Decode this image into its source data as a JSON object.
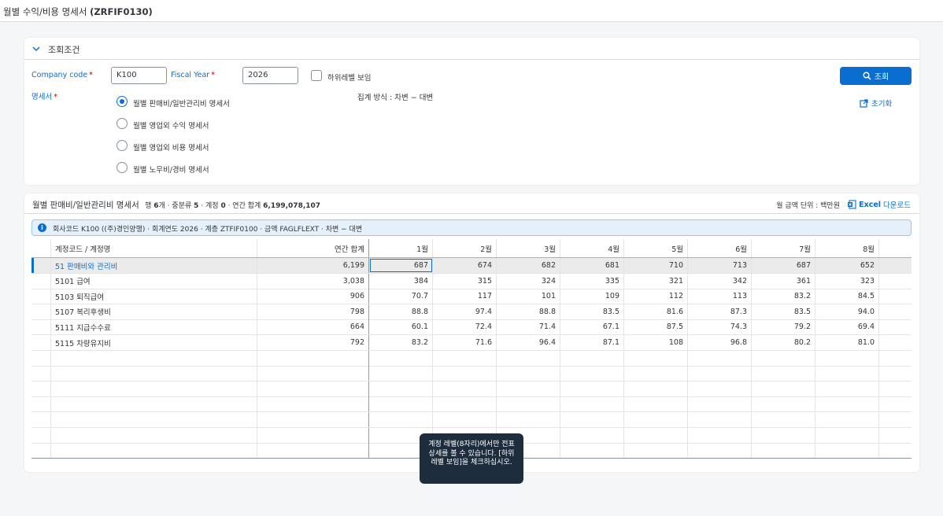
{
  "app": {
    "title_prefix": "월별 수익/비용 명세서",
    "title_code": "(ZRFIF0130)"
  },
  "conditions": {
    "section_title": "조회조건",
    "company_code_label": "Company code",
    "company_code_value": "K100",
    "fiscal_year_label": "Fiscal Year",
    "fiscal_year_value": "2026",
    "show_sublevel_label": "하위레벨 보임",
    "statement_label": "명세서",
    "aggregation_note": "집계 방식 : 차변 − 대변",
    "search_label": "조회",
    "reset_label": "초기화",
    "required_mark": "*",
    "statements": [
      {
        "label": "월별 판매비/일반관리비 명세서",
        "selected": true
      },
      {
        "label": "월별 영업외 수익 명세서",
        "selected": false
      },
      {
        "label": "월별 영업외 비용 명세서",
        "selected": false
      },
      {
        "label": "월별 노무비/경비 명세서",
        "selected": false
      }
    ]
  },
  "results": {
    "title": "월별 판매비/일반관리비 명세서",
    "meta_rows_label": "행",
    "meta_rows": "6",
    "meta_rows_unit": "개 · 중분류",
    "meta_mid": "5",
    "meta_acct_label": " · 계정",
    "meta_acct": "0",
    "meta_total_label": " · 연간 합계",
    "meta_total": "6,199,078,107",
    "unit_label": "월 금액 단위 :",
    "unit_value": "백만원",
    "excel_bold": "Excel",
    "excel_rest": "다운로드",
    "info": "회사코드 K100 ((주)경인양행) · 회계연도 2026 · 계층 ZTFIF0100 · 금액 FAGLFLEXT · 차변 − 대변",
    "columns": {
      "account": "계정코드 / 계정명",
      "annual": "연간 합계",
      "months": [
        "1월",
        "2월",
        "3월",
        "4월",
        "5월",
        "6월",
        "7월",
        "8월"
      ]
    },
    "rows": [
      {
        "name": "51 판매비와 관리비",
        "annual": "6,199",
        "m": [
          "687",
          "674",
          "682",
          "681",
          "710",
          "713",
          "687",
          "652"
        ]
      },
      {
        "name": "5101 급여",
        "annual": "3,038",
        "m": [
          "384",
          "315",
          "324",
          "335",
          "321",
          "342",
          "361",
          "323"
        ]
      },
      {
        "name": "5103 퇴직급여",
        "annual": "906",
        "m": [
          "70.7",
          "117",
          "101",
          "109",
          "112",
          "113",
          "83.2",
          "84.5"
        ]
      },
      {
        "name": "5107 복리후생비",
        "annual": "798",
        "m": [
          "88.8",
          "97.4",
          "88.8",
          "83.5",
          "81.6",
          "87.3",
          "83.5",
          "94.0"
        ]
      },
      {
        "name": "5111 지급수수료",
        "annual": "664",
        "m": [
          "60.1",
          "72.4",
          "71.4",
          "67.1",
          "87.5",
          "74.3",
          "79.2",
          "69.4"
        ]
      },
      {
        "name": "5115 차량유지비",
        "annual": "792",
        "m": [
          "83.2",
          "71.6",
          "96.4",
          "87.1",
          "108",
          "96.8",
          "80.2",
          "81.0"
        ]
      }
    ]
  },
  "tooltip": "계정 레벨(8자리)에서만 전표 상세를 볼 수 있습니다. [하위레벨 보임]을 체크하십시오.",
  "colors": {
    "accent": "#0a6ed1",
    "tooltip_bg": "#1d2d3e",
    "info_bg": "#e5f0fa"
  }
}
